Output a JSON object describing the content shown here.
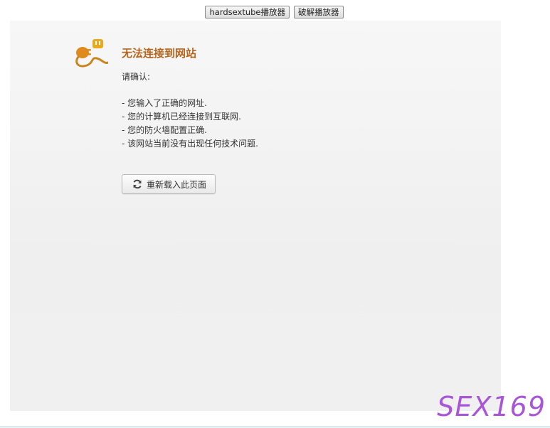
{
  "toolbar": {
    "player_button_label": "hardsextube播放器",
    "crack_button_label": "破解播放器"
  },
  "error": {
    "icon": "unplugged-plug-icon",
    "title": "无法连接到网站",
    "intro": "请确认:",
    "checks": [
      "- 您输入了正确的网址.",
      "- 您的计算机已经连接到互联网.",
      "- 您的防火墙配置正确.",
      "- 该网站当前没有出现任何技术问题."
    ],
    "reload_label": "重新载入此页面",
    "reload_icon": "refresh-icon"
  },
  "watermark": {
    "text": "SEX169"
  },
  "colors": {
    "title": "#b5651d",
    "icon_accent": "#e8a91d",
    "watermark": "#a855d8"
  }
}
